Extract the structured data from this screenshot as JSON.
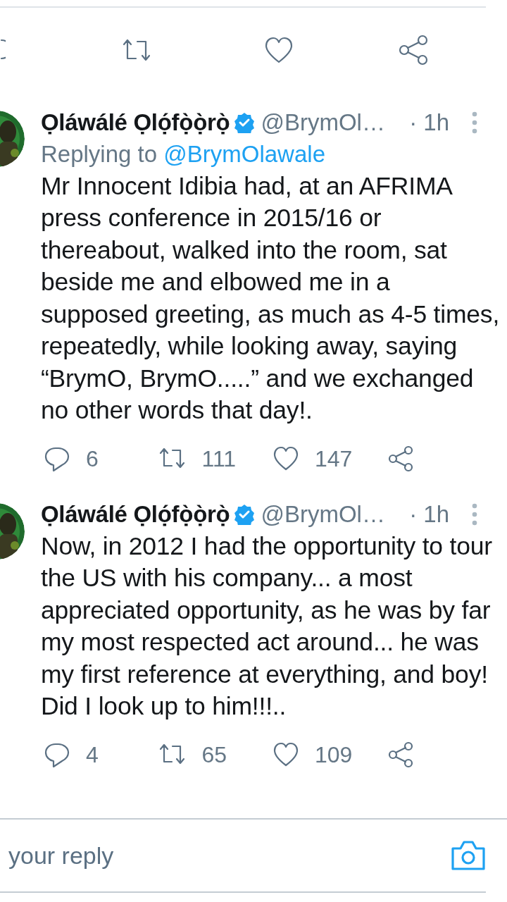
{
  "tweets": [
    {
      "name": "Ọláwálé  Ọlọ́fọ̀ọ̀rọ̀",
      "verified": true,
      "handle": "@BrymOl…",
      "time": "· 1h",
      "reply_to_label": "Replying to",
      "reply_to": "@BrymOlawale",
      "text": "Mr Innocent Idibia had, at an AFRIMA press conference in 2015/16 or thereabout, walked into the room, sat beside me and elbowed me in a supposed greeting, as much as 4-5 times, repeatedly, while looking away, saying  “BrymO, BrymO.....” and we exchanged no other words that day!.",
      "replies": "6",
      "retweets": "111",
      "likes": "147"
    },
    {
      "name": "Ọláwálé  Ọlọ́fọ̀ọ̀rọ̀",
      "verified": true,
      "handle": "@BrymOl…",
      "time": "· 1h",
      "text": "Now, in 2012 I had the opportunity to tour the US with his company... a most appreciated opportunity, as he was by far my most respected act around...  he was my first reference at everything, and boy! Did I look up to him!!!..",
      "replies": "4",
      "retweets": "65",
      "likes": "109"
    }
  ],
  "reply_box": {
    "placeholder": "your reply"
  }
}
